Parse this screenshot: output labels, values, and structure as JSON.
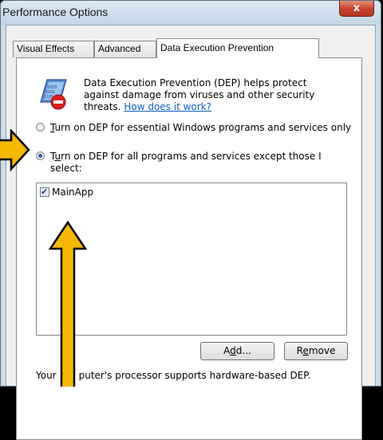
{
  "window": {
    "title": "Performance Options",
    "close_label": "x"
  },
  "tabs": [
    {
      "label": "Visual Effects",
      "active": false
    },
    {
      "label": "Advanced",
      "active": false
    },
    {
      "label": "Data Execution Prevention",
      "active": true
    }
  ],
  "dep": {
    "description": "Data Execution Prevention (DEP) helps protect against damage from viruses and other security threats.",
    "link_text": "How does it work?"
  },
  "options": {
    "essential": {
      "label_u": "T",
      "label_rest": "urn on DEP for essential Windows programs and services only",
      "selected": false
    },
    "all": {
      "label_pre": "T",
      "label_u": "u",
      "label_rest": "rn on DEP for all programs and services except those I select:",
      "selected": true
    }
  },
  "exceptions_list": [
    {
      "name": "MainApp",
      "checked": true
    }
  ],
  "buttons": {
    "add_pre": "A",
    "add_u": "d",
    "add_rest": "d...",
    "remove_pre": "R",
    "remove_u": "e",
    "remove_rest": "move"
  },
  "status_text": {
    "part1": "Your",
    "part2": "puter's processor supports hardware-based DEP."
  },
  "colors": {
    "arrow": "#f5b800",
    "arrow_outline": "#000000"
  }
}
